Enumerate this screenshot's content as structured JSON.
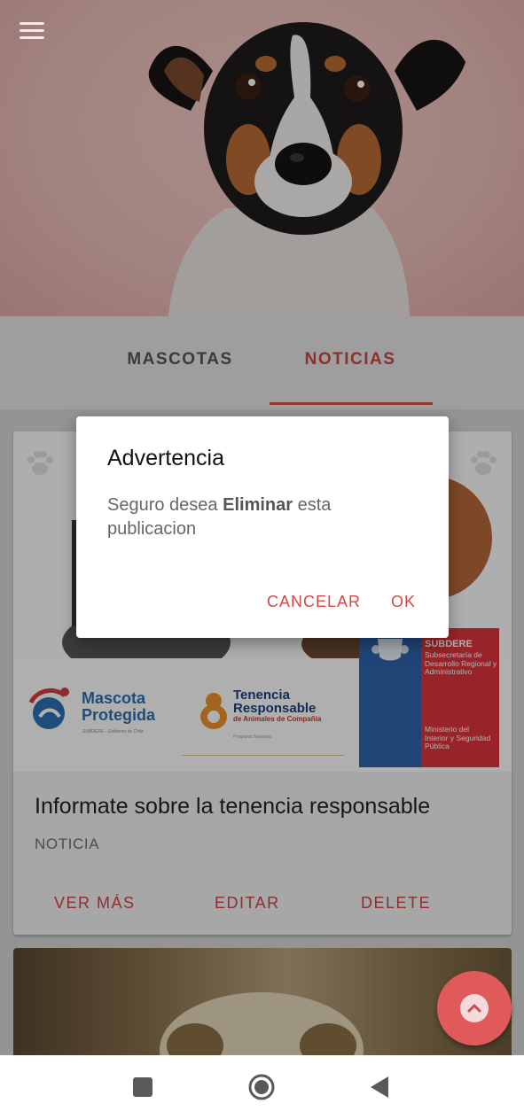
{
  "header": {
    "menu_icon": "hamburger-menu-icon"
  },
  "tabs": [
    {
      "label": "MASCOTAS",
      "selected": false
    },
    {
      "label": "NOTICIAS",
      "selected": true
    }
  ],
  "card": {
    "logos": {
      "mascota_protegida": {
        "line1": "Mascota",
        "line2": "Protegida",
        "sub": "SUBDERE - Gobierno de Chile"
      },
      "tenencia_responsable": {
        "line1": "Tenencia",
        "line2": "Responsable",
        "line3": "de Animales de Compañía",
        "sub": "Programa Nacional"
      },
      "subdere": {
        "title": "SUBDERE",
        "subtitle": "Subsecretaría de Desarrollo Regional y Administrativo",
        "ministry": "Ministerio del Interior y Seguridad Pública"
      }
    },
    "title": "Informate sobre la tenencia responsable",
    "subtitle": "NOTICIA",
    "actions": {
      "more": "VER MÁS",
      "edit": "EDITAR",
      "delete": "DELETE"
    }
  },
  "dialog": {
    "title": "Advertencia",
    "body_prefix": "Seguro desea ",
    "body_bold": "Eliminar",
    "body_suffix": " esta publicacion",
    "cancel": "CANCELAR",
    "ok": "OK"
  },
  "fab": {
    "icon": "chevron-up-icon"
  },
  "navbar": {
    "icons": [
      "square-recents-icon",
      "circle-home-icon",
      "triangle-back-icon"
    ]
  },
  "colors": {
    "accent": "#d94c4c",
    "scrim": "rgba(0,0,0,0.30)",
    "navbar": "#ffffff"
  }
}
